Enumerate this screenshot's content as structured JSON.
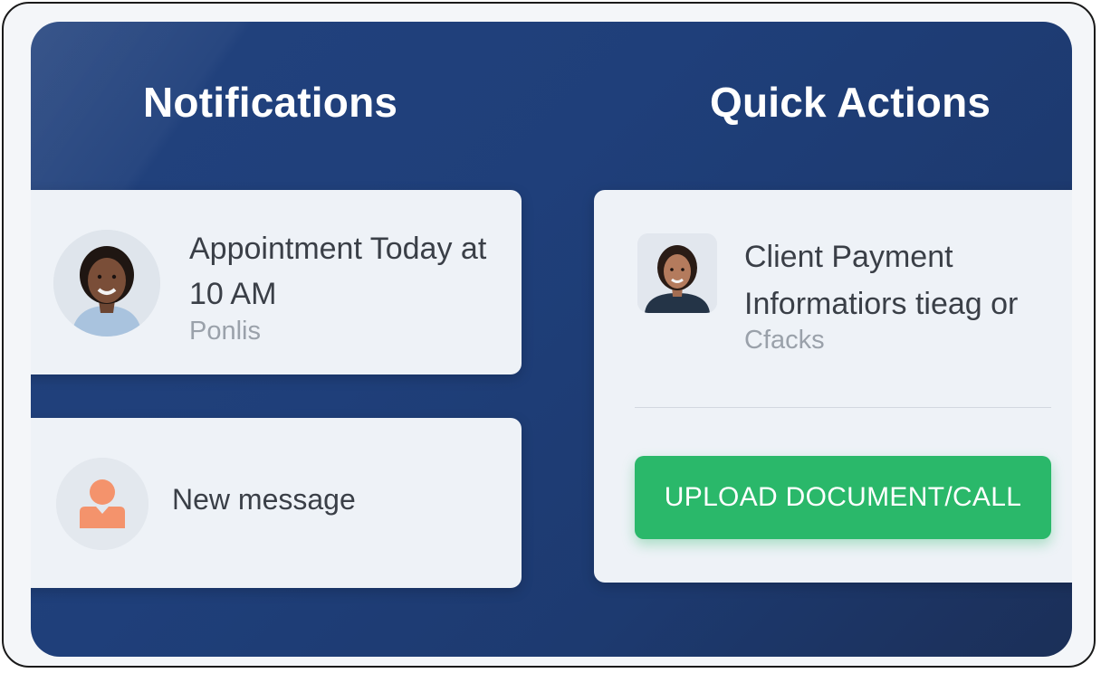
{
  "notifications": {
    "heading": "Notifications",
    "appointment": {
      "title": "Appointment Today at 10 AM",
      "subtitle": "Ponlis"
    },
    "message": {
      "label": "New message"
    }
  },
  "quick_actions": {
    "heading": "Quick Actions",
    "client": {
      "title": "Client Payment Informatiors tieag or",
      "subtitle": "Cfacks"
    },
    "upload_button": "UPLOAD DOCUMENT/CALL"
  },
  "colors": {
    "panel_background": "#1f3f7a",
    "card_background": "#eef2f7",
    "accent_button": "#2ab86a",
    "message_icon": "#f4936c"
  },
  "icons": {
    "appointment_avatar": "person-photo-icon",
    "message_avatar": "person-silhouette-icon",
    "client_avatar": "person-photo-icon"
  }
}
